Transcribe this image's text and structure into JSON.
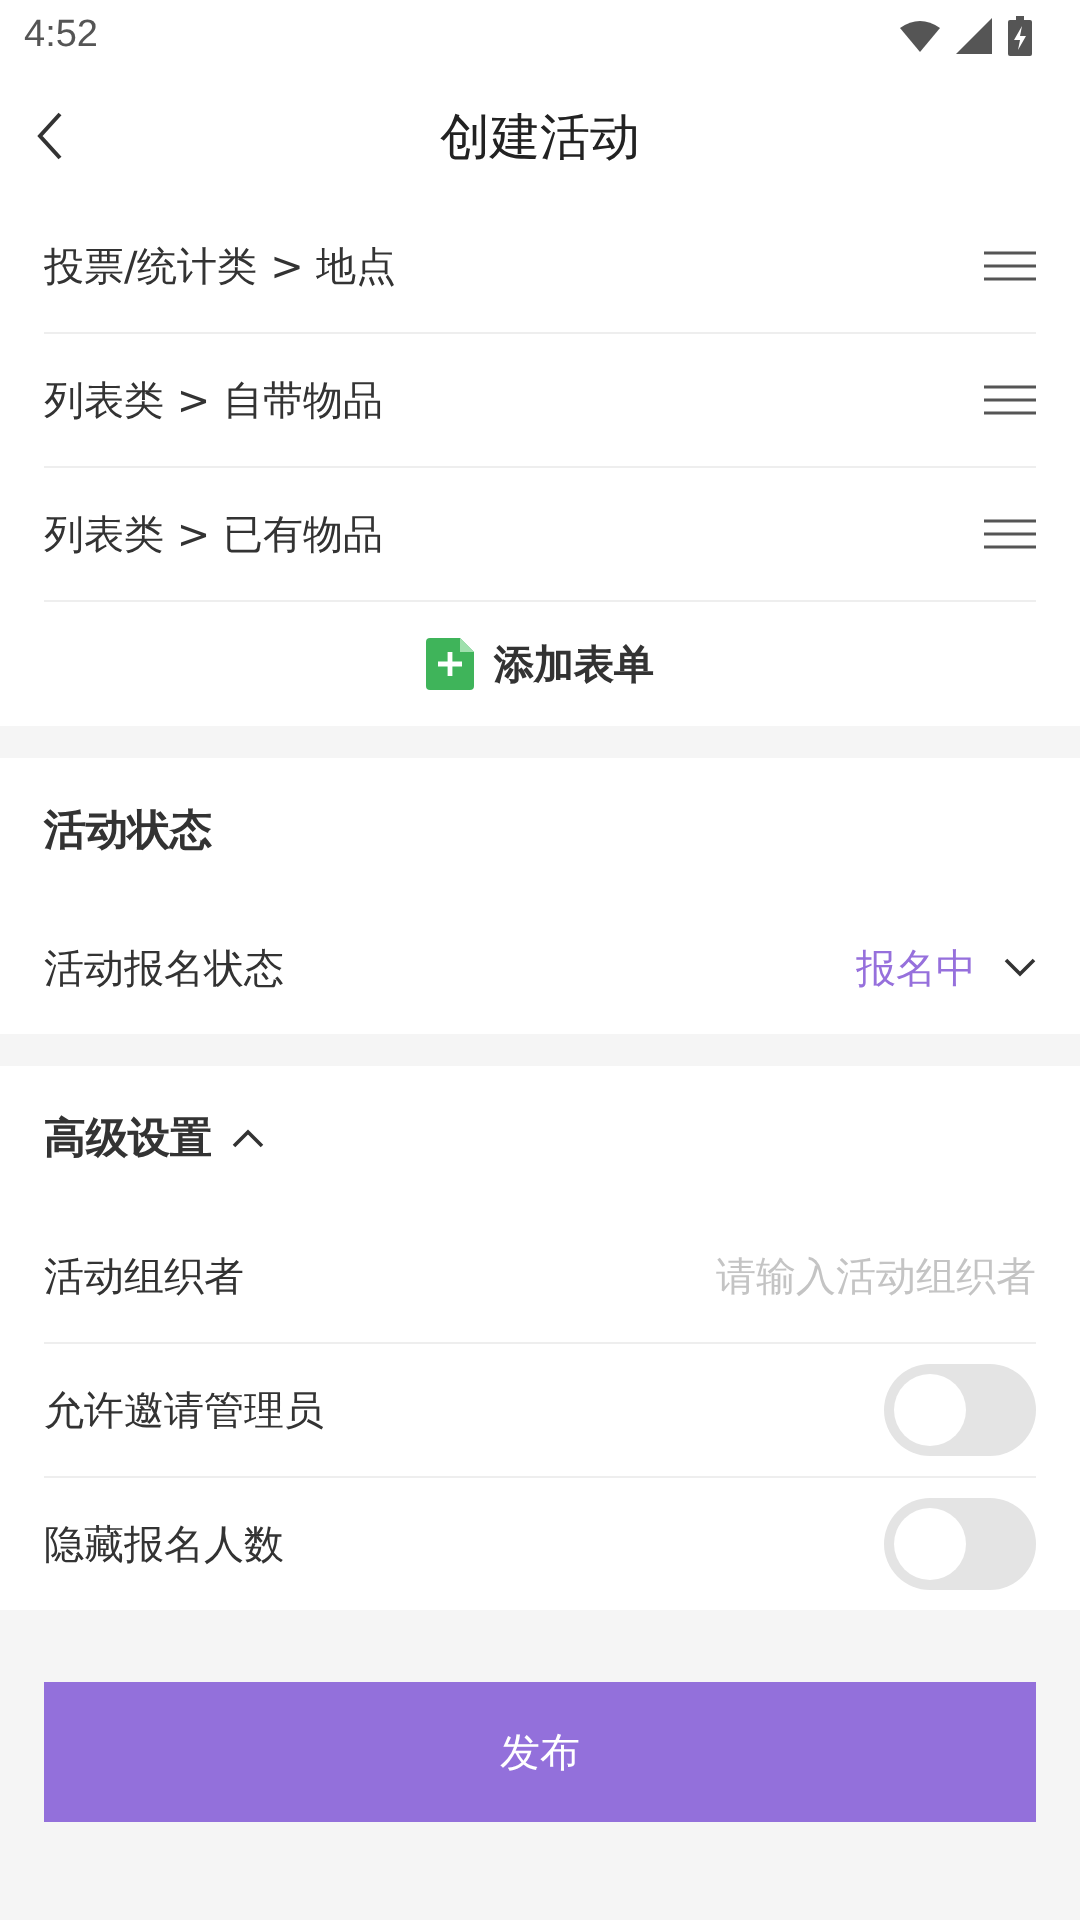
{
  "status_bar": {
    "time": "4:52"
  },
  "header": {
    "title": "创建活动"
  },
  "form_items": [
    {
      "label": "投票/统计类 > 地点"
    },
    {
      "label": "列表类 > 自带物品"
    },
    {
      "label": "列表类 > 已有物品"
    }
  ],
  "add_form_button": {
    "label": "添加表单"
  },
  "status_section": {
    "title": "活动状态",
    "row": {
      "label": "活动报名状态",
      "value": "报名中",
      "expanded": false
    }
  },
  "advanced_section": {
    "title": "高级设置",
    "expanded": true,
    "organizer": {
      "label": "活动组织者",
      "placeholder": "请输入活动组织者"
    },
    "toggles": [
      {
        "label": "允许邀请管理员",
        "on": false
      },
      {
        "label": "隐藏报名人数",
        "on": false
      }
    ]
  },
  "publish_button": {
    "label": "发布"
  }
}
